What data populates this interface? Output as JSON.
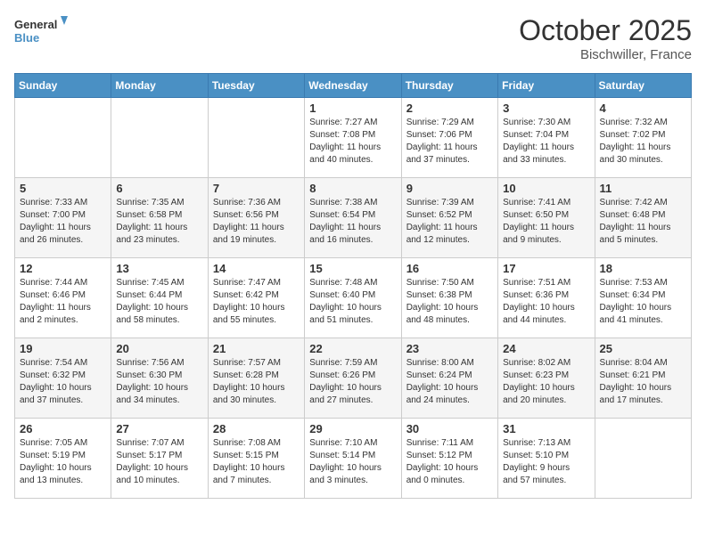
{
  "header": {
    "logo_line1": "General",
    "logo_line2": "Blue",
    "month": "October 2025",
    "location": "Bischwiller, France"
  },
  "weekdays": [
    "Sunday",
    "Monday",
    "Tuesday",
    "Wednesday",
    "Thursday",
    "Friday",
    "Saturday"
  ],
  "weeks": [
    [
      {
        "day": "",
        "info": ""
      },
      {
        "day": "",
        "info": ""
      },
      {
        "day": "",
        "info": ""
      },
      {
        "day": "1",
        "info": "Sunrise: 7:27 AM\nSunset: 7:08 PM\nDaylight: 11 hours\nand 40 minutes."
      },
      {
        "day": "2",
        "info": "Sunrise: 7:29 AM\nSunset: 7:06 PM\nDaylight: 11 hours\nand 37 minutes."
      },
      {
        "day": "3",
        "info": "Sunrise: 7:30 AM\nSunset: 7:04 PM\nDaylight: 11 hours\nand 33 minutes."
      },
      {
        "day": "4",
        "info": "Sunrise: 7:32 AM\nSunset: 7:02 PM\nDaylight: 11 hours\nand 30 minutes."
      }
    ],
    [
      {
        "day": "5",
        "info": "Sunrise: 7:33 AM\nSunset: 7:00 PM\nDaylight: 11 hours\nand 26 minutes."
      },
      {
        "day": "6",
        "info": "Sunrise: 7:35 AM\nSunset: 6:58 PM\nDaylight: 11 hours\nand 23 minutes."
      },
      {
        "day": "7",
        "info": "Sunrise: 7:36 AM\nSunset: 6:56 PM\nDaylight: 11 hours\nand 19 minutes."
      },
      {
        "day": "8",
        "info": "Sunrise: 7:38 AM\nSunset: 6:54 PM\nDaylight: 11 hours\nand 16 minutes."
      },
      {
        "day": "9",
        "info": "Sunrise: 7:39 AM\nSunset: 6:52 PM\nDaylight: 11 hours\nand 12 minutes."
      },
      {
        "day": "10",
        "info": "Sunrise: 7:41 AM\nSunset: 6:50 PM\nDaylight: 11 hours\nand 9 minutes."
      },
      {
        "day": "11",
        "info": "Sunrise: 7:42 AM\nSunset: 6:48 PM\nDaylight: 11 hours\nand 5 minutes."
      }
    ],
    [
      {
        "day": "12",
        "info": "Sunrise: 7:44 AM\nSunset: 6:46 PM\nDaylight: 11 hours\nand 2 minutes."
      },
      {
        "day": "13",
        "info": "Sunrise: 7:45 AM\nSunset: 6:44 PM\nDaylight: 10 hours\nand 58 minutes."
      },
      {
        "day": "14",
        "info": "Sunrise: 7:47 AM\nSunset: 6:42 PM\nDaylight: 10 hours\nand 55 minutes."
      },
      {
        "day": "15",
        "info": "Sunrise: 7:48 AM\nSunset: 6:40 PM\nDaylight: 10 hours\nand 51 minutes."
      },
      {
        "day": "16",
        "info": "Sunrise: 7:50 AM\nSunset: 6:38 PM\nDaylight: 10 hours\nand 48 minutes."
      },
      {
        "day": "17",
        "info": "Sunrise: 7:51 AM\nSunset: 6:36 PM\nDaylight: 10 hours\nand 44 minutes."
      },
      {
        "day": "18",
        "info": "Sunrise: 7:53 AM\nSunset: 6:34 PM\nDaylight: 10 hours\nand 41 minutes."
      }
    ],
    [
      {
        "day": "19",
        "info": "Sunrise: 7:54 AM\nSunset: 6:32 PM\nDaylight: 10 hours\nand 37 minutes."
      },
      {
        "day": "20",
        "info": "Sunrise: 7:56 AM\nSunset: 6:30 PM\nDaylight: 10 hours\nand 34 minutes."
      },
      {
        "day": "21",
        "info": "Sunrise: 7:57 AM\nSunset: 6:28 PM\nDaylight: 10 hours\nand 30 minutes."
      },
      {
        "day": "22",
        "info": "Sunrise: 7:59 AM\nSunset: 6:26 PM\nDaylight: 10 hours\nand 27 minutes."
      },
      {
        "day": "23",
        "info": "Sunrise: 8:00 AM\nSunset: 6:24 PM\nDaylight: 10 hours\nand 24 minutes."
      },
      {
        "day": "24",
        "info": "Sunrise: 8:02 AM\nSunset: 6:23 PM\nDaylight: 10 hours\nand 20 minutes."
      },
      {
        "day": "25",
        "info": "Sunrise: 8:04 AM\nSunset: 6:21 PM\nDaylight: 10 hours\nand 17 minutes."
      }
    ],
    [
      {
        "day": "26",
        "info": "Sunrise: 7:05 AM\nSunset: 5:19 PM\nDaylight: 10 hours\nand 13 minutes."
      },
      {
        "day": "27",
        "info": "Sunrise: 7:07 AM\nSunset: 5:17 PM\nDaylight: 10 hours\nand 10 minutes."
      },
      {
        "day": "28",
        "info": "Sunrise: 7:08 AM\nSunset: 5:15 PM\nDaylight: 10 hours\nand 7 minutes."
      },
      {
        "day": "29",
        "info": "Sunrise: 7:10 AM\nSunset: 5:14 PM\nDaylight: 10 hours\nand 3 minutes."
      },
      {
        "day": "30",
        "info": "Sunrise: 7:11 AM\nSunset: 5:12 PM\nDaylight: 10 hours\nand 0 minutes."
      },
      {
        "day": "31",
        "info": "Sunrise: 7:13 AM\nSunset: 5:10 PM\nDaylight: 9 hours\nand 57 minutes."
      },
      {
        "day": "",
        "info": ""
      }
    ]
  ]
}
